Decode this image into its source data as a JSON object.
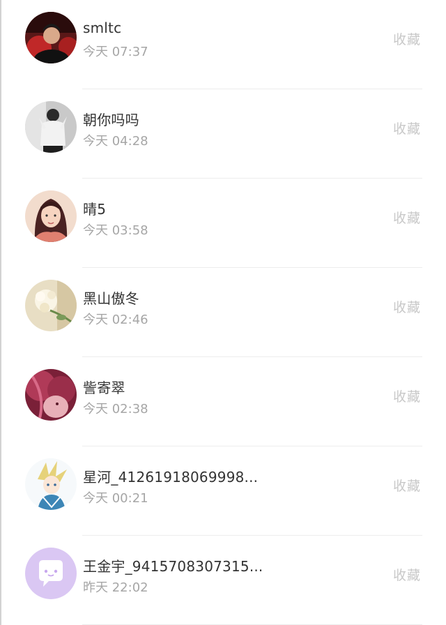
{
  "contacts": [
    {
      "name": "smltc",
      "time": "今天 07:37",
      "action": "收藏",
      "avatar_colors": [
        "#3a1a1a",
        "#c23030"
      ]
    },
    {
      "name": "朝你吗吗",
      "time": "今天 04:28",
      "action": "收藏",
      "avatar_colors": [
        "#d0d0d0",
        "#404040"
      ]
    },
    {
      "name": "晴5",
      "time": "今天 03:58",
      "action": "收藏",
      "avatar_colors": [
        "#f3d9c8",
        "#5a2a2a"
      ]
    },
    {
      "name": "黑山傲冬",
      "time": "今天 02:46",
      "action": "收藏",
      "avatar_colors": [
        "#efe7cf",
        "#b8a67a"
      ]
    },
    {
      "name": "訾寄翠",
      "time": "今天 02:38",
      "action": "收藏",
      "avatar_colors": [
        "#8a2a45",
        "#d07090"
      ]
    },
    {
      "name": "星河_41261918069998...",
      "time": "今天 00:21",
      "action": "收藏",
      "avatar_colors": [
        "#eaf2f6",
        "#3a7aa8"
      ]
    },
    {
      "name": "王金宇_9415708307315...",
      "time": "昨天 22:02",
      "action": "收藏",
      "avatar_colors": [
        "#d9c6f2",
        "#ffffff"
      ]
    }
  ]
}
